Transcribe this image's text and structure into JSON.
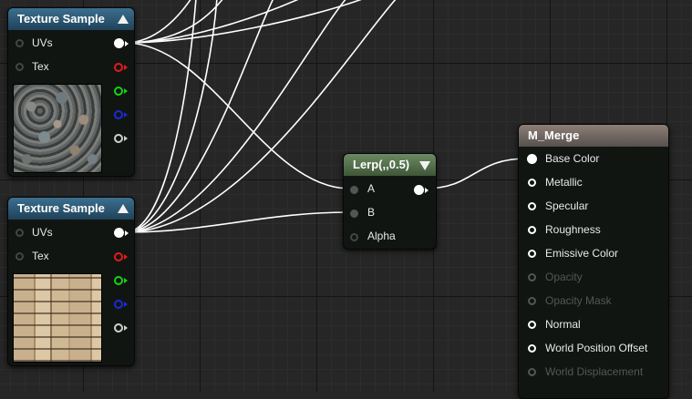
{
  "texture_nodes": [
    {
      "title": "Texture Sample",
      "inputs": [
        "UVs",
        "Tex"
      ],
      "outputs": [
        "white",
        "red",
        "green",
        "blue",
        "gray"
      ],
      "thumbnail": "stones"
    },
    {
      "title": "Texture Sample",
      "inputs": [
        "UVs",
        "Tex"
      ],
      "outputs": [
        "white",
        "red",
        "green",
        "blue",
        "gray"
      ],
      "thumbnail": "bricks"
    }
  ],
  "lerp_node": {
    "title": "Lerp(,,0.5)",
    "inputs": [
      "A",
      "B",
      "Alpha"
    ]
  },
  "material_node": {
    "title": "M_Merge",
    "inputs": [
      {
        "label": "Base Color",
        "state": "connected"
      },
      {
        "label": "Metallic",
        "state": "active"
      },
      {
        "label": "Specular",
        "state": "active"
      },
      {
        "label": "Roughness",
        "state": "active"
      },
      {
        "label": "Emissive Color",
        "state": "active"
      },
      {
        "label": "Opacity",
        "state": "disabled"
      },
      {
        "label": "Opacity Mask",
        "state": "disabled"
      },
      {
        "label": "Normal",
        "state": "active"
      },
      {
        "label": "World Position Offset",
        "state": "active"
      },
      {
        "label": "World Displacement",
        "state": "disabled"
      }
    ]
  },
  "colors": {
    "background": "#262626",
    "wire": "#ffffff",
    "texture_header": "#2f5a76",
    "lerp_header": "#56724e",
    "material_header": "#766c66"
  }
}
